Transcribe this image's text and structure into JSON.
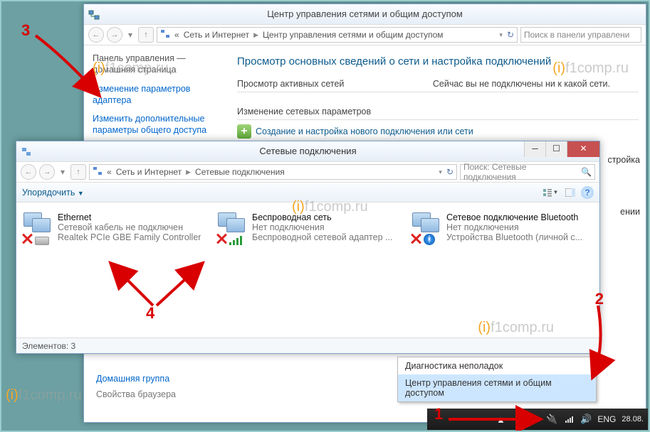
{
  "win1": {
    "title": "Центр управления сетями и общим доступом",
    "crumb1": "Сеть и Интернет",
    "crumb2": "Центр управления сетями и общим доступом",
    "search_ph": "Поиск в панели управлени",
    "side_home1": "Панель управления —",
    "side_home2": "домашняя страница",
    "side_link1a": "Изменение параметров",
    "side_link1b": "адаптера",
    "side_link2a": "Изменить дополнительные",
    "side_link2b": "параметры общего доступа",
    "main_h": "Просмотр основных сведений о сети и настройка подключений",
    "sec1_h": "Просмотр активных сетей",
    "sec1_txt": "Сейчас вы не подключены ни к какой сети.",
    "sec2_h": "Изменение сетевых параметров",
    "sec2_link": "Создание и настройка нового подключения или сети",
    "right_word": "стройка",
    "right_word2": "ении",
    "bottom1": "Домашняя группа",
    "bottom2": "Свойства браузера"
  },
  "win2": {
    "title": "Сетевые подключения",
    "crumb1": "Сеть и Интернет",
    "crumb2": "Сетевые подключения",
    "search_ph": "Поиск: Сетевые подключения",
    "sort_label": "Упорядочить",
    "conns": [
      {
        "name": "Ethernet",
        "s1": "Сетевой кабель не подключен",
        "s2": "Realtek PCIe GBE Family Controller"
      },
      {
        "name": "Беспроводная сеть",
        "s1": "Нет подключения",
        "s2": "Беспроводной сетевой адаптер ..."
      },
      {
        "name": "Сетевое подключение Bluetooth",
        "s1": "Нет подключения",
        "s2": "Устройства Bluetooth (личной с..."
      }
    ],
    "status": "Элементов: 3"
  },
  "ctx": {
    "row1": "Диагностика неполадок",
    "row2": "Центр управления сетями и общим доступом"
  },
  "tray": {
    "lang": "ENG",
    "date": "28.08."
  },
  "anno": {
    "n1": "1",
    "n2": "2",
    "n3": "3",
    "n4": "4"
  },
  "wm": "f1comp.ru"
}
